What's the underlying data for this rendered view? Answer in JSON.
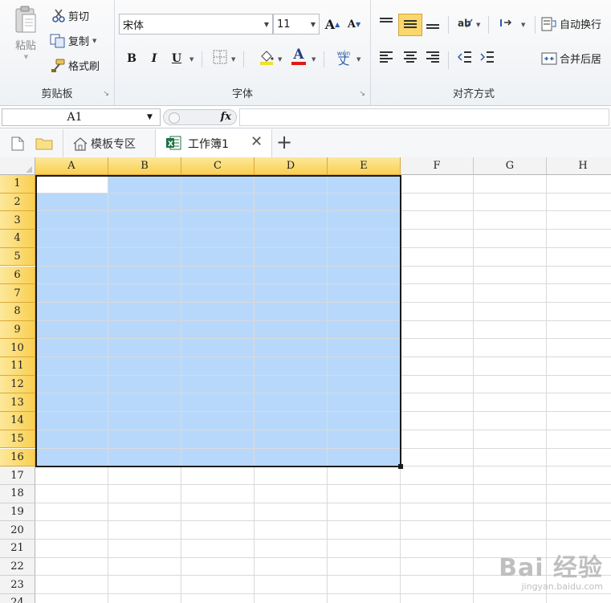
{
  "ribbon": {
    "clipboard": {
      "label": "剪贴板",
      "paste": "粘贴",
      "cut": "剪切",
      "copy": "复制",
      "format_painter": "格式刷"
    },
    "font": {
      "label": "字体",
      "font_name": "宋体",
      "font_size": "11",
      "bold": "B",
      "italic": "I",
      "underline": "U",
      "grow": "A",
      "shrink": "A",
      "font_color": "A",
      "phonetic": "wén"
    },
    "alignment": {
      "label": "对齐方式",
      "wrap_text": "自动换行",
      "merge_center": "合并后居"
    }
  },
  "formula_bar": {
    "cell_ref": "A1",
    "fx": "fx",
    "value": ""
  },
  "tabs": {
    "template_zone": "模板专区",
    "workbook": "工作簿1",
    "new_tab": "+"
  },
  "sheet": {
    "columns": [
      "A",
      "B",
      "C",
      "D",
      "E",
      "F",
      "G",
      "H"
    ],
    "rows": [
      "1",
      "2",
      "3",
      "4",
      "5",
      "6",
      "7",
      "8",
      "9",
      "10",
      "11",
      "12",
      "13",
      "14",
      "15",
      "16",
      "17",
      "18",
      "19",
      "20",
      "21",
      "22",
      "23",
      "24"
    ],
    "selection": {
      "start": "A1",
      "end": "E16"
    }
  },
  "watermark": {
    "brand": "Bai 经验",
    "url": "jingyan.baidu.com"
  },
  "colors": {
    "selection": "#b7d8fb",
    "header_selected": "#f9cf52",
    "excel_green": "#1e7145"
  }
}
